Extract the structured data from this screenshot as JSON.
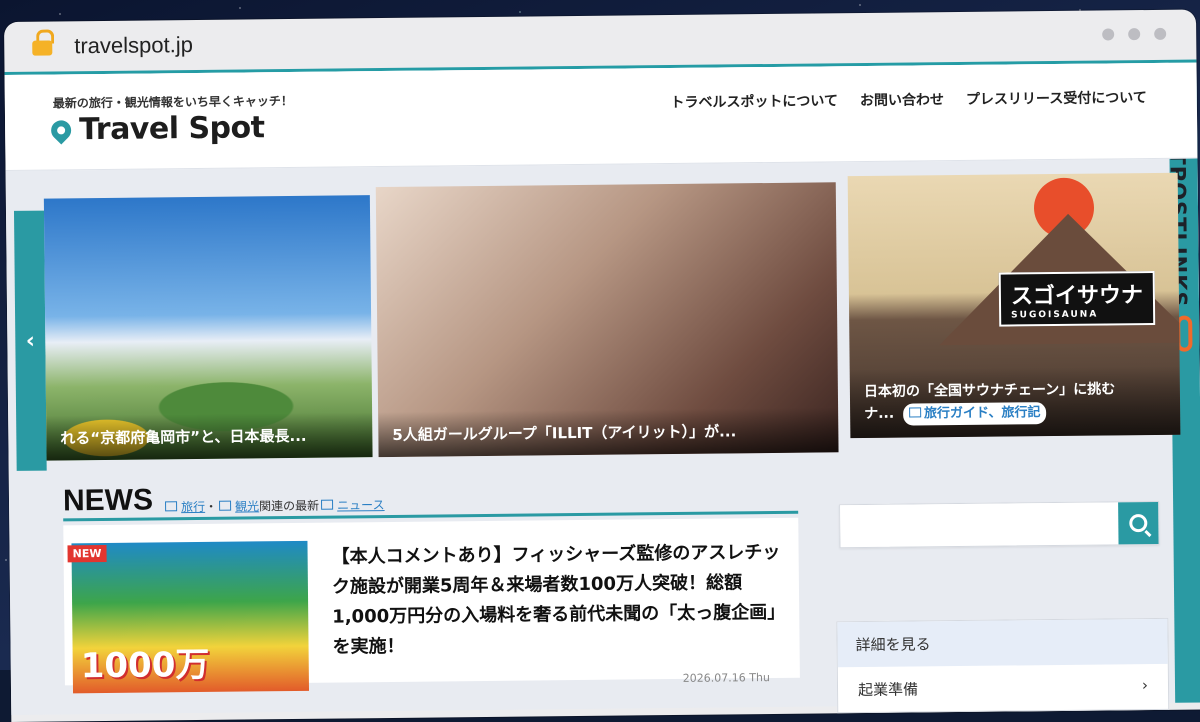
{
  "browser": {
    "url": "travelspot.jp"
  },
  "site": {
    "tagline": "最新の旅行・観光情報をいち早くキャッチ！",
    "logo": "Travel Spot",
    "nav": [
      "トラベルスポットについて",
      "お問い合わせ",
      "プレスリリース受付について"
    ]
  },
  "side_brand": "GUESTPOSTLINKS",
  "slider": {
    "prev_label": "‹",
    "slides": [
      {
        "caption": "れる“京都府亀岡市”と、日本最長..."
      },
      {
        "caption": "5人組ガールグループ「ILLIT（アイリット）」が..."
      },
      {
        "caption": "日本初の「全国サウナチェーン」に挑む",
        "caption2": "ナ...",
        "tag": "旅行ガイド、旅行記",
        "art_title": "スゴイサウナ",
        "art_sub": "SUGOISAUNA"
      }
    ]
  },
  "news": {
    "title": "NEWS",
    "link1": "旅行",
    "sep": "・",
    "link2": "観光",
    "mid": "関連の最新",
    "link3": "ニュース",
    "badge": "NEW",
    "thumb_text": "1000万",
    "article": "【本人コメントあり】フィッシャーズ監修のアスレチック施設が開業5周年＆来場者数100万人突破！総額1,000万円分の入場料を奢る前代未聞の「太っ腹企画」を実施！",
    "date": "2026.07.16 Thu"
  },
  "search": {
    "placeholder": ""
  },
  "sidebar": {
    "heading": "詳細を見る",
    "items": [
      "起業準備"
    ]
  }
}
